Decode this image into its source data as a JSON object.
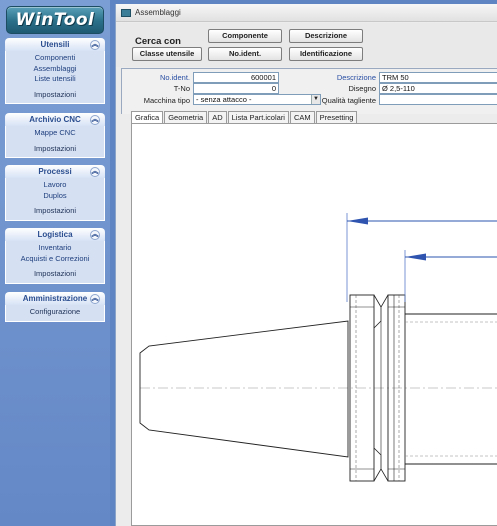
{
  "app": {
    "logo_text": "WinTool"
  },
  "sidebar": {
    "groups": [
      {
        "title": "Utensili",
        "links": [
          "Componenti",
          "Assemblaggi",
          "Liste utensili"
        ],
        "footer": "Impostazioni"
      },
      {
        "title": "Archivio CNC",
        "links": [
          "Mappe CNC"
        ],
        "footer": "Impostazioni"
      },
      {
        "title": "Processi",
        "links": [
          "Lavoro",
          "Duplos"
        ],
        "footer": "Impostazioni"
      },
      {
        "title": "Logistica",
        "links": [
          "Inventario",
          "Acquisti e Correzioni"
        ],
        "footer": "Impostazioni"
      },
      {
        "title": "Amministrazione",
        "links": [],
        "footer": "Configurazione"
      }
    ]
  },
  "window": {
    "title": "Assemblaggi"
  },
  "search": {
    "label": "Cerca con",
    "buttons": [
      "Componente",
      "Descrizione",
      "Classe utensile",
      "No.ident.",
      "Identificazione"
    ]
  },
  "form": {
    "noident_label": "No.ident.",
    "noident_value": "600001",
    "tno_label": "T-No",
    "tno_value": "0",
    "macchina_label": "Macchina tipo",
    "macchina_value": "- senza attacco -",
    "descrizione_label": "Descrizione",
    "descrizione_value": "TRM 50",
    "disegno_label": "Disegno",
    "disegno_value": "Ø 2,5-110",
    "qualita_label": "Qualità tagliente",
    "qualita_value": ""
  },
  "tabs": [
    "Grafica",
    "Geometria",
    "AD",
    "Lista Part.icolari",
    "CAM",
    "Presetting"
  ],
  "active_tab": "Grafica",
  "colors": {
    "accent_blue": "#2a4fa3",
    "sidebar_bg": "#6d91cb",
    "dimension_line": "#2e54b0"
  }
}
